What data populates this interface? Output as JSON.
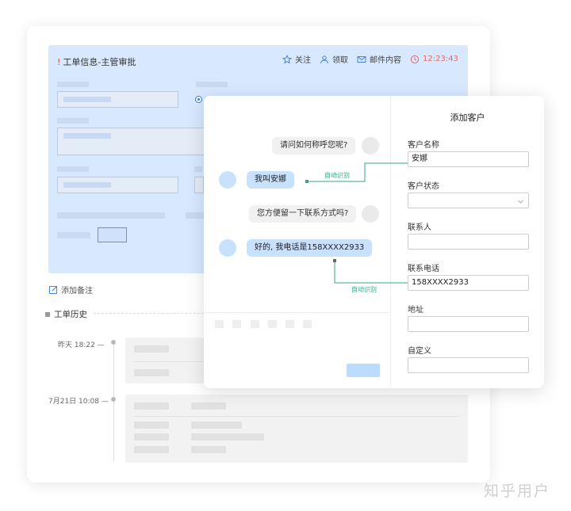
{
  "workorder": {
    "title_mark": "!",
    "title": "工单信息-主管审批",
    "actions": {
      "follow": "关注",
      "claim": "领取",
      "mail": "邮件内容",
      "timer": "12:23:43"
    },
    "add_note": "添加备注",
    "history": {
      "title": "工单历史",
      "entries": [
        {
          "time": "昨天  18:22  —"
        },
        {
          "time": "7月21日  10:08  —"
        }
      ]
    }
  },
  "chat": {
    "messages": [
      {
        "text": "请问如何称呼您呢?"
      },
      {
        "text": "我叫安娜"
      },
      {
        "text": "您方便留一下联系方式吗?"
      },
      {
        "text": "好的, 我电话是158XXXX2933"
      }
    ],
    "auto_detect_1": "自动识别",
    "auto_detect_2": "自动识别"
  },
  "form": {
    "title": "添加客户",
    "fields": [
      {
        "label": "客户名称",
        "value": "安娜"
      },
      {
        "label": "客户状态",
        "value": ""
      },
      {
        "label": "联系人",
        "value": ""
      },
      {
        "label": "联系电话",
        "value": "158XXXX2933"
      },
      {
        "label": "地址",
        "value": ""
      },
      {
        "label": "自定义",
        "value": ""
      }
    ]
  },
  "colors": {
    "accent": "#3a7bd5",
    "panel_blue": "#d7e8ff",
    "bubble_blue": "#c7e1ff",
    "link_green": "#3aa58a",
    "timer_red": "#e06b6b"
  },
  "watermark": "知乎用户"
}
